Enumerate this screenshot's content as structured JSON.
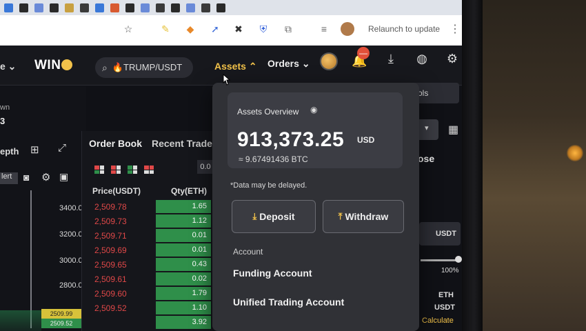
{
  "browser": {
    "relaunch_label": "Relaunch to update",
    "kebab": "⋮"
  },
  "header": {
    "nav_left_label": "e",
    "logo_text": "WIN",
    "search_value": "🔥TRUMP/USDT",
    "assets_label": "Assets",
    "orders_label": "Orders",
    "notification_badge": "—"
  },
  "left_panel": {
    "own_label": "wn",
    "own_value": "3",
    "depth_label": "epth",
    "alert_label": "lert",
    "price_axis": [
      "3400.00",
      "3200.00",
      "3000.00",
      "2800.00"
    ],
    "tag_yellow": "2509.99",
    "tag_green": "2509.52"
  },
  "order_book": {
    "tab_order_book": "Order Book",
    "tab_recent_trades": "Recent Trades",
    "step_value": "0.0",
    "col_price": "Price(USDT)",
    "col_qty": "Qty(ETH)",
    "rows": [
      {
        "price": "2,509.78",
        "qty": "1.65",
        "depth": 1.0
      },
      {
        "price": "2,509.73",
        "qty": "1.12",
        "depth": 1.0
      },
      {
        "price": "2,509.71",
        "qty": "0.01",
        "depth": 1.0
      },
      {
        "price": "2,509.69",
        "qty": "0.01",
        "depth": 1.0
      },
      {
        "price": "2,509.65",
        "qty": "0.43",
        "depth": 1.0
      },
      {
        "price": "2,509.61",
        "qty": "0.02",
        "depth": 1.0
      },
      {
        "price": "2,509.60",
        "qty": "1.79",
        "depth": 1.0
      },
      {
        "price": "2,509.52",
        "qty": "1.10",
        "depth": 1.0
      },
      {
        "price": "",
        "qty": "3.92",
        "depth": 1.0
      }
    ]
  },
  "right_panel": {
    "tools_label": "ols",
    "close_label": "ose",
    "currency_label": "USDT",
    "percent_label": "100%",
    "eth_label": "ETH",
    "usdt_label": "USDT",
    "calculate_label": "Calculate"
  },
  "assets_dropdown": {
    "overview_title": "Assets Overview",
    "total_amount": "913,373.25",
    "total_unit": "USD",
    "btc_equivalent": "≈ 9.67491436 BTC",
    "delay_note": "*Data may be delayed.",
    "deposit_label": "Deposit",
    "withdraw_label": "Withdraw",
    "section_account": "Account",
    "items": [
      "Funding Account",
      "Unified Trading Account"
    ]
  },
  "colors": {
    "accent": "#f2c24a",
    "ask_red": "#e04848",
    "bid_green": "#2f8f4a",
    "panel_bg": "#303136"
  }
}
